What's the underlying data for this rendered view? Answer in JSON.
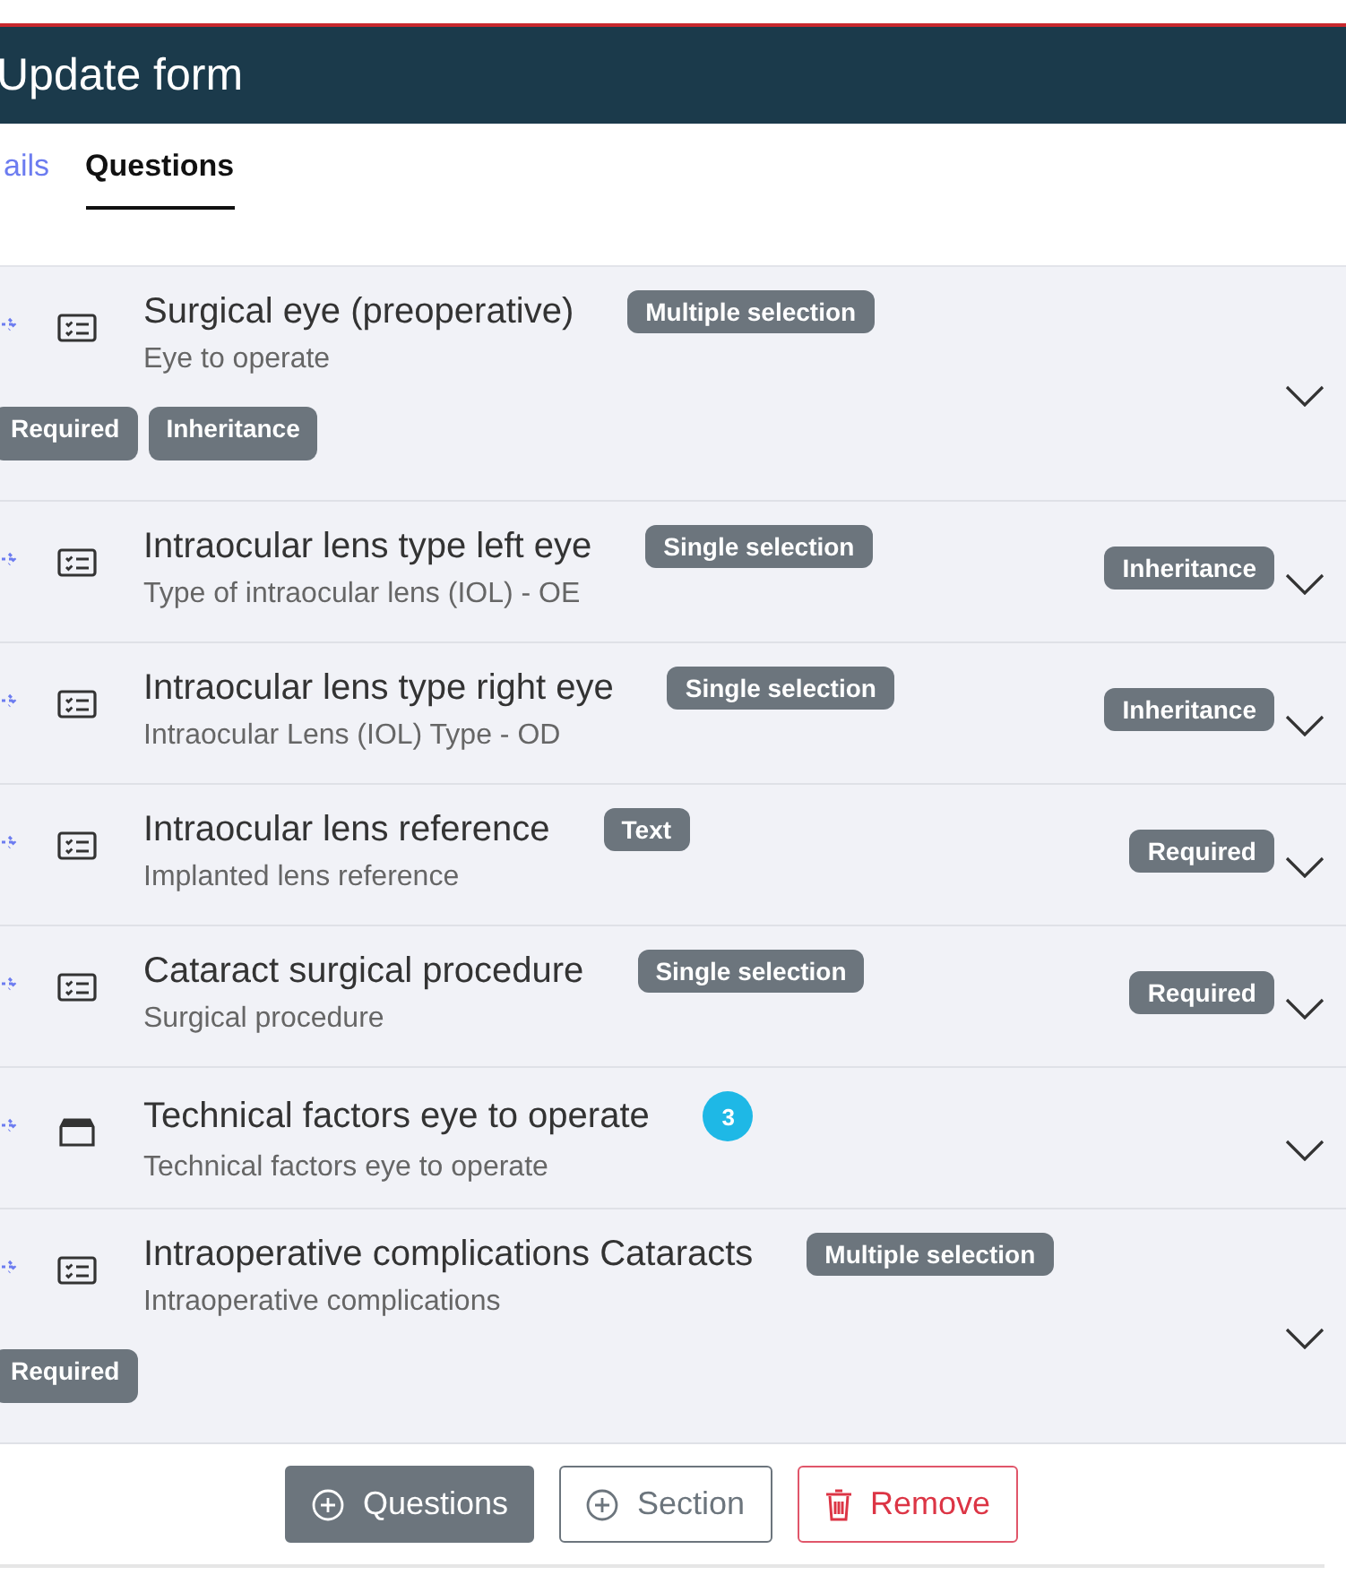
{
  "header": {
    "title": "Update form"
  },
  "tabs": [
    {
      "label": "ails",
      "selected": false
    },
    {
      "label": "Questions",
      "selected": true
    }
  ],
  "questions": [
    {
      "title": "Surgical eye (preoperative)",
      "subtitle": "Eye to operate",
      "kind": "list",
      "type": "Multiple selection",
      "bottom_tags": [
        "Required",
        "Inheritance"
      ]
    },
    {
      "title": "Intraocular lens type left eye",
      "subtitle": "Type of intraocular lens (IOL) - OE",
      "kind": "list",
      "type": "Single selection",
      "right_tags": [
        "Inheritance"
      ]
    },
    {
      "title": "Intraocular lens type right eye",
      "subtitle": "Intraocular Lens (IOL) Type - OD",
      "kind": "list",
      "type": "Single selection",
      "right_tags": [
        "Inheritance"
      ]
    },
    {
      "title": "Intraocular lens reference",
      "subtitle": "Implanted lens reference",
      "kind": "list",
      "type": "Text",
      "right_tags": [
        "Required"
      ]
    },
    {
      "title": "Cataract surgical procedure",
      "subtitle": "Surgical procedure",
      "kind": "list",
      "type": "Single selection",
      "right_tags": [
        "Required"
      ]
    },
    {
      "title": "Technical factors eye to operate",
      "subtitle": "Technical factors eye to operate",
      "kind": "group",
      "count": "3"
    },
    {
      "title": "Intraoperative complications Cataracts",
      "subtitle": "Intraoperative complications",
      "kind": "list",
      "type": "Multiple selection",
      "bottom_tags": [
        "Required"
      ]
    }
  ],
  "actions": [
    {
      "label": "Questions",
      "kind": "primary"
    },
    {
      "label": "Section",
      "kind": "outline"
    },
    {
      "label": "Remove",
      "kind": "danger"
    }
  ]
}
